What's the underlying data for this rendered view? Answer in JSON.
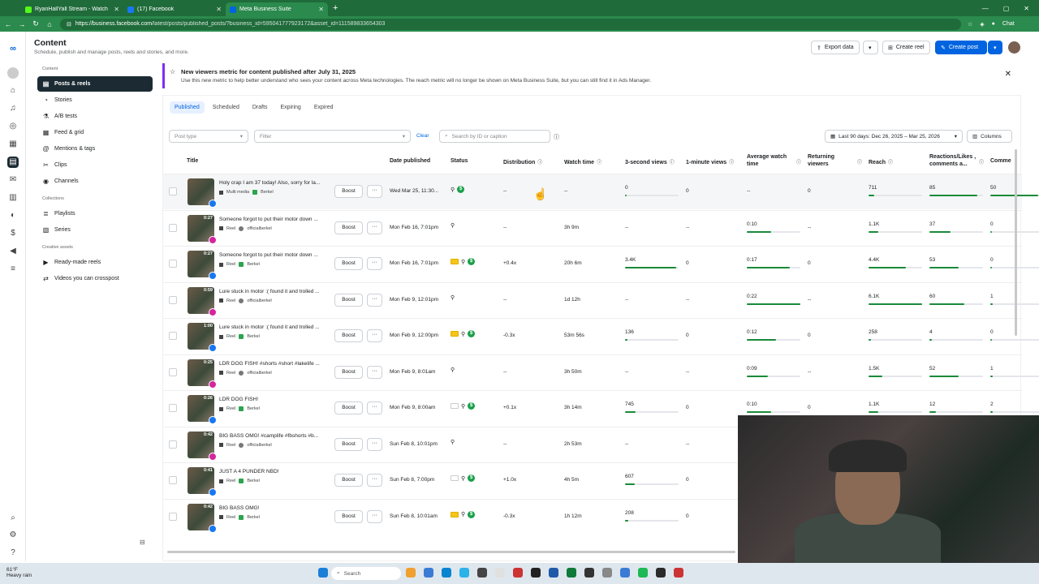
{
  "browser": {
    "tabs": [
      {
        "title": "RyanHallYall Stream - Watch",
        "color": "#53fc18",
        "active": false
      },
      {
        "title": "(17) Facebook",
        "color": "#1877f2",
        "active": false
      },
      {
        "title": "Meta Business Suite",
        "color": "#0064e0",
        "active": true
      }
    ],
    "url_host": "https://business.facebook.com",
    "url_path": "/latest/posts/published_posts/?business_id=595041777923172&asset_id=111589833654303",
    "chat_label": "Chat"
  },
  "header": {
    "title": "Content",
    "subtitle": "Schedule, publish and manage posts, reels and stories, and more.",
    "export_label": "Export data",
    "create_reel_label": "Create reel",
    "create_post_label": "Create post"
  },
  "sidebar": {
    "group_content": "Content",
    "items_content": [
      "Posts & reels",
      "Stories",
      "A/B tests",
      "Feed & grid",
      "Mentions & tags",
      "Clips",
      "Channels"
    ],
    "group_collections": "Collections",
    "items_collections": [
      "Playlists",
      "Series"
    ],
    "group_creative": "Creative assets",
    "items_creative": [
      "Ready-made reels",
      "Videos you can crosspost"
    ]
  },
  "banner": {
    "title": "New viewers metric for content published after July 31, 2025",
    "body": "Use this new metric to help better understand who sees your content across Meta technologies. The reach metric will no longer be shown on Meta Business Suite, but you can still find it in Ads Manager."
  },
  "tabs": [
    "Published",
    "Scheduled",
    "Drafts",
    "Expiring",
    "Expired"
  ],
  "filters": {
    "post_type_placeholder": "Post type",
    "filter_placeholder": "Filter",
    "clear_label": "Clear",
    "search_placeholder": "Search by ID or caption",
    "date_range": "Last 90 days: Dec 26, 2025 – Mar 25, 2026",
    "columns_label": "Columns"
  },
  "columns": [
    "Title",
    "Date published",
    "Status",
    "Distribution",
    "Watch time",
    "3-second views",
    "1-minute views",
    "Average watch time",
    "Returning viewers",
    "Reach",
    "Reactions/Likes , comments a...",
    "Comme"
  ],
  "boost_label": "Boost",
  "more_label": "···",
  "rows": [
    {
      "title": "Holy crap I am 37 today! Also, sorry for la...",
      "type": "Multi media",
      "account": "Berkel",
      "platform": "fb",
      "duration": "",
      "date": "Wed Mar 25, 11:30...",
      "monetized": true,
      "badge": "none",
      "distribution": "--",
      "watch": "--",
      "views3": "0",
      "views1": "0",
      "avg": "--",
      "ret": "0",
      "reach": "711",
      "reactions": "85",
      "comments": "50",
      "bars": {
        "views3": 0,
        "avg": 0,
        "reach": 0.1,
        "react": 0.9,
        "comm": 0.9
      }
    },
    {
      "title": "Someone forgot to put their motor down ...",
      "type": "Reel",
      "account": "officialberkel",
      "platform": "ig",
      "duration": "0:27",
      "date": "Mon Feb 16, 7:01pm",
      "monetized": false,
      "badge": "none",
      "distribution": "--",
      "watch": "3h 9m",
      "views3": "--",
      "views1": "--",
      "avg": "0:10",
      "ret": "--",
      "reach": "1.1K",
      "reactions": "37",
      "comments": "0",
      "bars": {
        "views3": 0,
        "avg": 0.45,
        "reach": 0.18,
        "react": 0.4,
        "comm": 0
      }
    },
    {
      "title": "Someone forgot to put their motor down ...",
      "type": "Reel",
      "account": "Berkel",
      "platform": "fb",
      "duration": "0:27",
      "date": "Mon Feb 16, 7:01pm",
      "monetized": true,
      "badge": "yellow",
      "distribution": "+0.4x",
      "watch": "20h 6m",
      "views3": "3.4K",
      "views1": "0",
      "avg": "0:17",
      "ret": "0",
      "reach": "4.4K",
      "reactions": "53",
      "comments": "0",
      "bars": {
        "views3": 0.95,
        "avg": 0.8,
        "reach": 0.7,
        "react": 0.55,
        "comm": 0
      }
    },
    {
      "title": "Lure stuck in motor :( found it and trolled ...",
      "type": "Reel",
      "account": "officialberkel",
      "platform": "ig",
      "duration": "0:59",
      "date": "Mon Feb 9, 12:01pm",
      "monetized": false,
      "badge": "none",
      "distribution": "--",
      "watch": "1d 12h",
      "views3": "--",
      "views1": "--",
      "avg": "0:22",
      "ret": "--",
      "reach": "6.1K",
      "reactions": "60",
      "comments": "1",
      "bars": {
        "views3": 0,
        "avg": 1.0,
        "reach": 1.0,
        "react": 0.65,
        "comm": 0.05
      }
    },
    {
      "title": "Lure stuck in motor :( found it and trolled ...",
      "type": "Reel",
      "account": "Berkel",
      "platform": "fb",
      "duration": "1:00",
      "date": "Mon Feb 9, 12:00pm",
      "monetized": true,
      "badge": "yellow",
      "distribution": "-0.3x",
      "watch": "53m 56s",
      "views3": "136",
      "views1": "0",
      "avg": "0:12",
      "ret": "0",
      "reach": "258",
      "reactions": "4",
      "comments": "0",
      "bars": {
        "views3": 0.04,
        "avg": 0.55,
        "reach": 0.05,
        "react": 0.04,
        "comm": 0
      }
    },
    {
      "title": "LDR DOG FISH! #shorts #short #lakelife ...",
      "type": "Reel",
      "account": "officialberkel",
      "platform": "ig",
      "duration": "0:25",
      "date": "Mon Feb 9, 8:01am",
      "monetized": false,
      "badge": "none",
      "distribution": "--",
      "watch": "3h 50m",
      "views3": "--",
      "views1": "--",
      "avg": "0:09",
      "ret": "--",
      "reach": "1.5K",
      "reactions": "52",
      "comments": "1",
      "bars": {
        "views3": 0,
        "avg": 0.4,
        "reach": 0.25,
        "react": 0.55,
        "comm": 0.05
      }
    },
    {
      "title": "LDR DOG FISH!",
      "type": "Reel",
      "account": "Berkel",
      "platform": "fb",
      "duration": "0:26",
      "date": "Mon Feb 9, 8:00am",
      "monetized": true,
      "badge": "grey",
      "distribution": "+0.1x",
      "watch": "3h 14m",
      "views3": "745",
      "views1": "0",
      "avg": "0:10",
      "ret": "0",
      "reach": "1.1K",
      "reactions": "12",
      "comments": "2",
      "bars": {
        "views3": 0.2,
        "avg": 0.45,
        "reach": 0.18,
        "react": 0.12,
        "comm": 0.05
      }
    },
    {
      "title": "BIG BASS OMG! #camplife #fbshorts #b...",
      "type": "Reel",
      "account": "officialberkel",
      "platform": "ig",
      "duration": "0:42",
      "date": "Sun Feb 8, 10:01pm",
      "monetized": false,
      "badge": "none",
      "distribution": "--",
      "watch": "2h 53m",
      "views3": "--",
      "views1": "--",
      "avg": "",
      "ret": "",
      "reach": "",
      "reactions": "",
      "comments": "",
      "bars": {
        "views3": 0,
        "avg": 0,
        "reach": 0,
        "react": 0,
        "comm": 0
      }
    },
    {
      "title": "JUST A 4 PUNDER NBD!",
      "type": "Reel",
      "account": "Berkel",
      "platform": "fb",
      "duration": "0:41",
      "date": "Sun Feb 8, 7:00pm",
      "monetized": true,
      "badge": "grey",
      "distribution": "+1.0x",
      "watch": "4h 5m",
      "views3": "607",
      "views1": "0",
      "avg": "",
      "ret": "",
      "reach": "",
      "reactions": "",
      "comments": "",
      "bars": {
        "views3": 0.18,
        "avg": 0,
        "reach": 0,
        "react": 0,
        "comm": 0
      }
    },
    {
      "title": "BIG BASS OMG!",
      "type": "Reel",
      "account": "Berkel",
      "platform": "fb",
      "duration": "0:42",
      "date": "Sun Feb 8, 10:01am",
      "monetized": true,
      "badge": "yellow",
      "distribution": "-0.3x",
      "watch": "1h 12m",
      "views3": "208",
      "views1": "0",
      "avg": "",
      "ret": "",
      "reach": "",
      "reactions": "",
      "comments": "",
      "bars": {
        "views3": 0.06,
        "avg": 0,
        "reach": 0,
        "react": 0,
        "comm": 0
      }
    }
  ],
  "taskbar": {
    "temp": "61°F",
    "weather": "Heavy rain",
    "search_placeholder": "Search"
  }
}
